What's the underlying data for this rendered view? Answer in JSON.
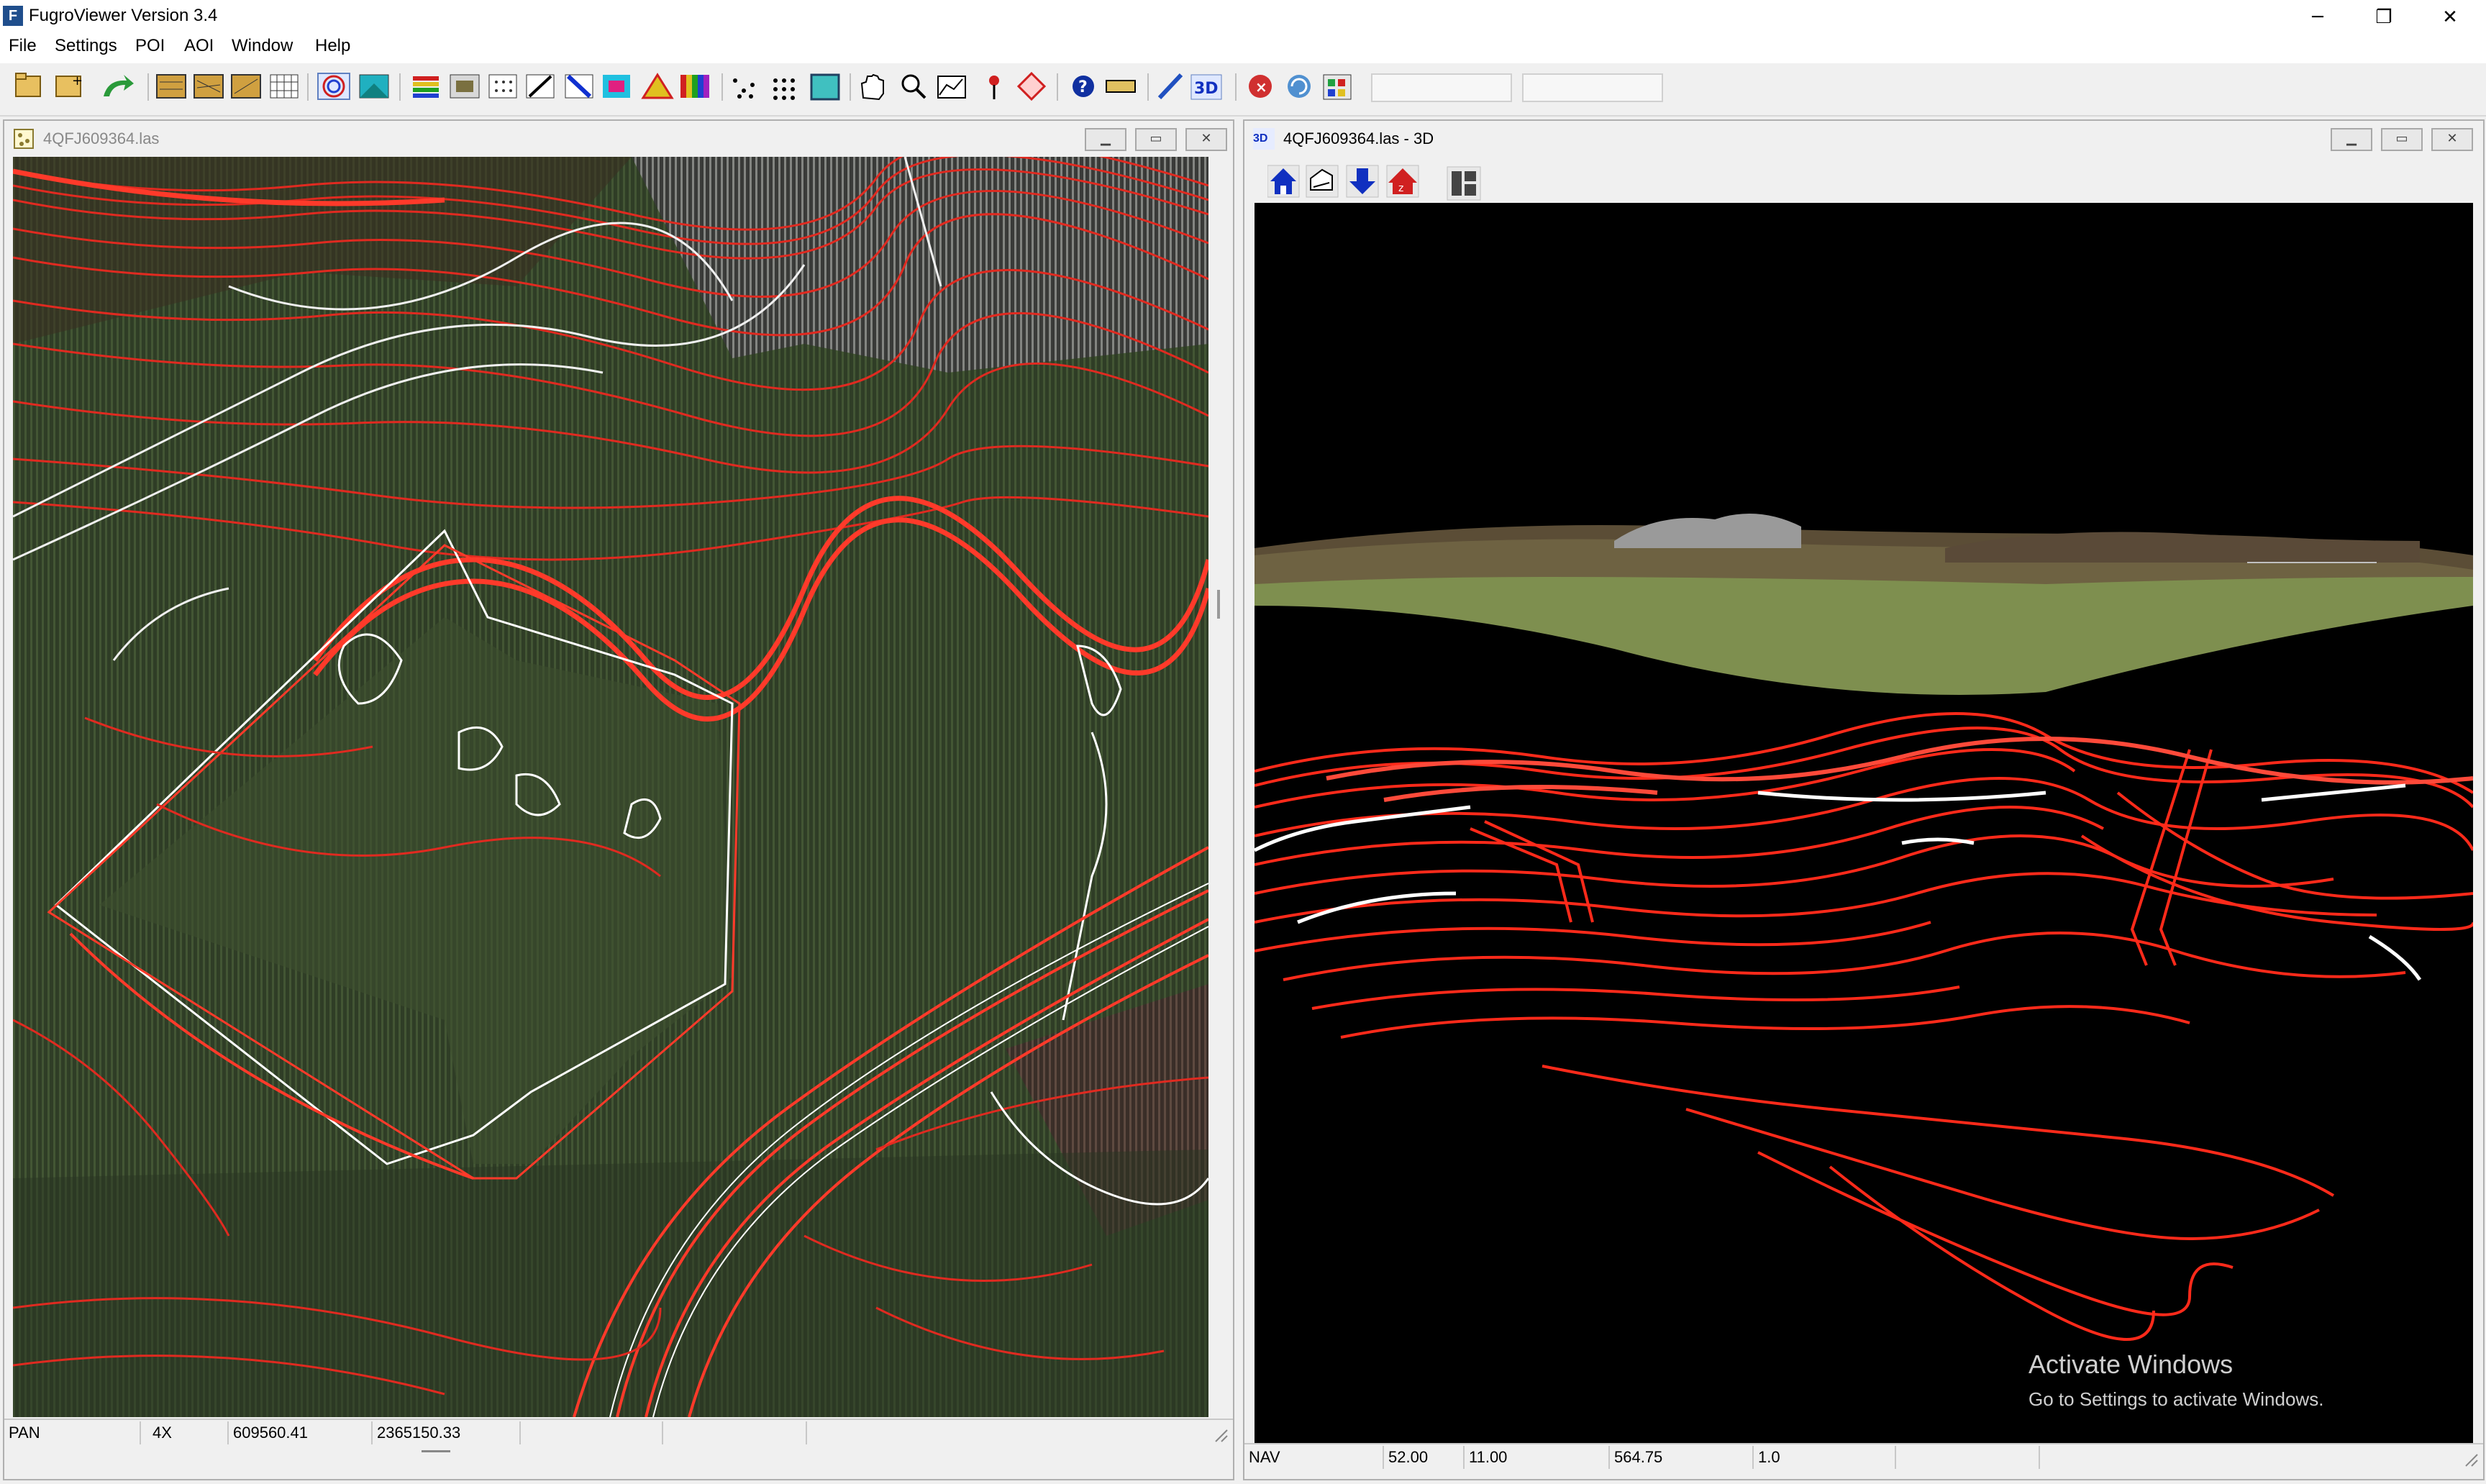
{
  "app": {
    "title": "FugroViewer  Version 3.4",
    "icon_letter": "F"
  },
  "window_controls": {
    "minimize": "─",
    "restore": "❐",
    "close": "✕"
  },
  "menu": [
    "File",
    "Settings",
    "POI",
    "AOI",
    "Window",
    "Help"
  ],
  "toolbar": {
    "buttons": [
      "open-file",
      "add-file",
      "redo-arrow",
      "layers-1",
      "layers-2",
      "layers-3",
      "grid-points",
      "contour-rainbow",
      "image-cyan",
      "color-bars",
      "gray-box",
      "dotted-grid",
      "line-diagonal",
      "blue-diagonal",
      "color-square",
      "rainbow-triangle",
      "rainbow-bars",
      "scatter-points",
      "dot-grid",
      "extent-box",
      "pan-hand",
      "zoom-box",
      "profile",
      "poi-pin",
      "aoi-diamond",
      "help-question",
      "ruler",
      "measure",
      "3d-view",
      "stop-red",
      "refresh",
      "settings-grid"
    ],
    "field1": "",
    "field2": ""
  },
  "plan_window": {
    "title": "4QFJ609364.las",
    "status": {
      "mode": "PAN",
      "zoom": "4X",
      "x": "609560.41",
      "y": "2365150.33",
      "extra1": "",
      "extra2": ""
    }
  },
  "view3d_window": {
    "title": "4QFJ609364.las - 3D",
    "icon_label": "3D",
    "tools": [
      "home-icon",
      "layers-icon",
      "down-arrow-icon",
      "up-home-icon",
      "panels-icon"
    ],
    "status": {
      "mode": "NAV",
      "v1": "52.00",
      "v2": "11.00",
      "v3": "564.75",
      "v4": "1.0",
      "extra": ""
    }
  },
  "watermark": {
    "line1": "Activate Windows",
    "line2": "Go to Settings to activate Windows."
  },
  "colors": {
    "contour_red": "#e02a20",
    "contour_white": "#ffffff",
    "terrain_dark": "#2b3a24",
    "terrain_green": "#8a9a5a"
  }
}
